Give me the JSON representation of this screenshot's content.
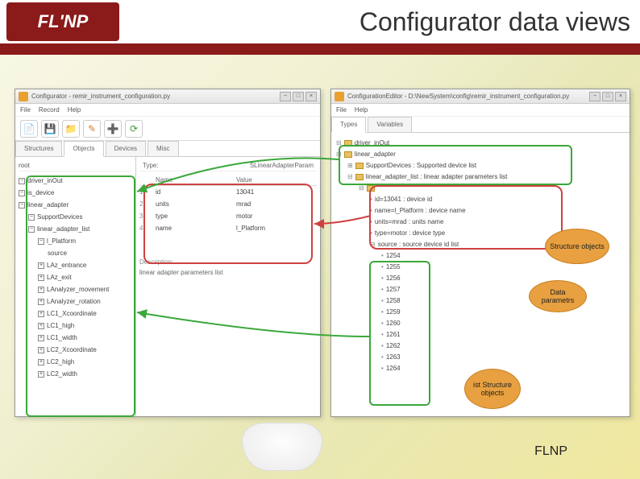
{
  "header": {
    "logo": "FL'NP",
    "title": "Configurator data views"
  },
  "footer": "FLNP",
  "win1": {
    "title": "Configurator - remir_instrument_configuration.py",
    "menus": [
      "File",
      "Record",
      "Help"
    ],
    "tabs": [
      "Structures",
      "Objects",
      "Devices",
      "Misc"
    ],
    "root": "root",
    "type_label": "Type:",
    "type_value": "SLinearAdapterParam",
    "tree": [
      "driver_inOut",
      "is_device",
      "linear_adapter",
      "SupportDevices",
      "linear_adapter_list",
      "l_Platform",
      "source",
      "LAz_entrance",
      "LAz_exit",
      "LAnalyzer_movement",
      "LAnalyzer_rotation",
      "LC1_Xcoordinate",
      "LC1_high",
      "LC1_width",
      "LC2_Xcoordinate",
      "LC2_high",
      "LC2_width"
    ],
    "param_headers": [
      "",
      "Name",
      "Value"
    ],
    "params": [
      {
        "n": "1",
        "name": "id",
        "value": "13041"
      },
      {
        "n": "2",
        "name": "units",
        "value": "mrad"
      },
      {
        "n": "3",
        "name": "type",
        "value": "motor"
      },
      {
        "n": "4",
        "name": "name",
        "value": "l_Platform"
      }
    ],
    "desc_label": "Description:",
    "desc_text": "linear adapter parameters list"
  },
  "win2": {
    "title": "ConfigurationEditor - D:\\NewSystem\\config\\remir_instrument_configuration.py",
    "menus": [
      "File",
      "Help"
    ],
    "tabs": [
      "Types",
      "Variables"
    ],
    "tree": [
      "driver_inOut",
      "linear_adapter",
      "SupportDevices : Supported device list",
      "linear_adapter_list : linear adapter parameters list",
      "id=13041 : device id",
      "name=l_Platform : device name",
      "units=mrad : units name",
      "type=motor : device type",
      "source : source device id list",
      "1254",
      "1255",
      "1256",
      "1257",
      "1258",
      "1259",
      "1260",
      "1261",
      "1262",
      "1263",
      "1264"
    ]
  },
  "clouds": {
    "c1": "Structure objects",
    "c2": "Data parametrs",
    "c3": "ist Structure objects"
  }
}
